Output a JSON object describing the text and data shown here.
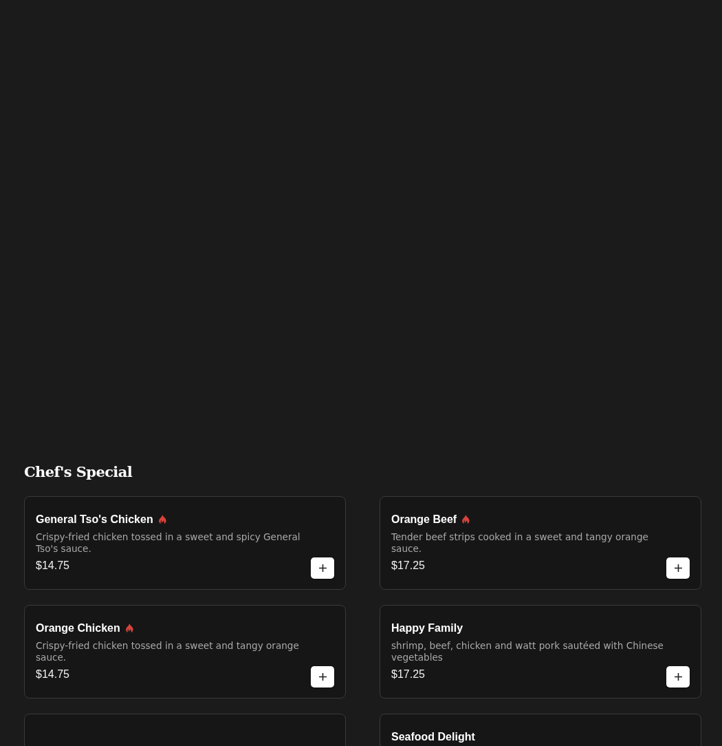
{
  "section": {
    "title": "Chef's Special"
  },
  "items": [
    {
      "kind": "dish",
      "name": "General Tso's Chicken",
      "spicy": true,
      "description": "Crispy-fried chicken tossed in a sweet and spicy General Tso's sauce.",
      "price": "$14.75"
    },
    {
      "kind": "dish",
      "name": "Orange Beef",
      "spicy": true,
      "description": "Tender beef strips cooked in a sweet and tangy orange sauce.",
      "price": "$17.25"
    },
    {
      "kind": "dish",
      "name": "Orange Chicken",
      "spicy": true,
      "description": "Crispy-fried chicken tossed in a sweet and tangy orange sauce.",
      "price": "$14.75"
    },
    {
      "kind": "dish",
      "name": "Happy Family",
      "spicy": false,
      "description": "shrimp, beef, chicken and watt pork sautéed with Chinese vegetables",
      "price": "$17.25"
    },
    {
      "kind": "empty"
    },
    {
      "kind": "dish",
      "name": "Seafood Delight",
      "spicy": false
    }
  ]
}
